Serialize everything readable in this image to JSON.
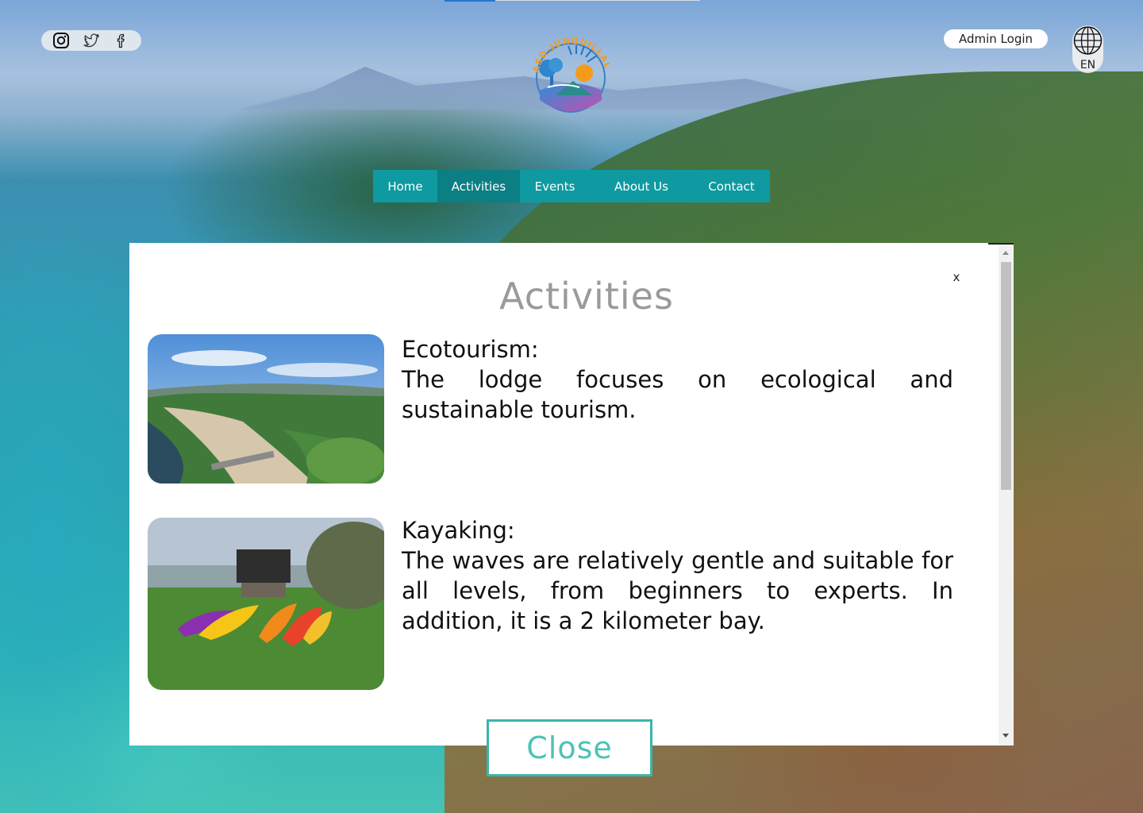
{
  "header": {
    "social": [
      {
        "name": "instagram",
        "icon": "instagram-icon"
      },
      {
        "name": "twitter",
        "icon": "twitter-icon"
      },
      {
        "name": "facebook",
        "icon": "facebook-icon"
      }
    ],
    "logo_text": "ASD-JUNQUILLAL",
    "admin_login_label": "Admin Login",
    "language_code": "EN"
  },
  "nav": {
    "items": [
      {
        "label": "Home"
      },
      {
        "label": "Activities"
      },
      {
        "label": "Events"
      },
      {
        "label": "About Us"
      },
      {
        "label": "Contact"
      }
    ],
    "active": "Activities"
  },
  "modal": {
    "close_x_label": "x",
    "title": "Activities",
    "activities": [
      {
        "heading": "Ecotourism:",
        "text": "The lodge focuses on ecological and sustainable tourism."
      },
      {
        "heading": "Kayaking:",
        "text": "The waves are relatively gentle and suitable for all levels, from beginners to experts. In addition, it is a 2 kilometer bay."
      }
    ],
    "close_button_label": "Close"
  },
  "colors": {
    "nav_bg": "#0e9aa0",
    "nav_active": "#0b7f84",
    "close_border": "#3bb5aa",
    "close_text": "#4cc3b7",
    "title_gray": "#9a9a9a"
  }
}
